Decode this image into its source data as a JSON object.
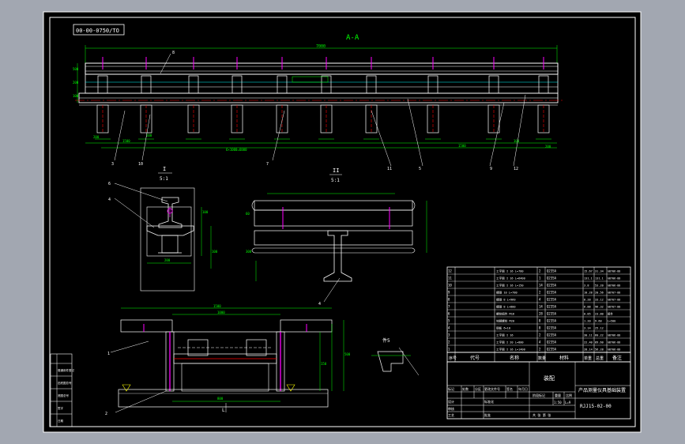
{
  "drawing": {
    "tag_label": "00-00-0750/TO",
    "section_title": "A-A",
    "detail_I_label": "I",
    "detail_I_scale": "5:1",
    "detail_II_label": "II",
    "detail_II_scale": "5:1",
    "detail_marker": "件5",
    "sub_label": "L",
    "drawing_number": "RJJ15-02-00",
    "title_text": "产品测量仪具基础装置",
    "title_caption": "装配",
    "scale_text": "1:50",
    "weight_text": "L=9",
    "top_dimension": "7000",
    "view_number_labels": [
      "3",
      "10",
      "7",
      "11",
      "5",
      "9",
      "12",
      "8",
      "6",
      "4",
      "2",
      "1"
    ],
    "section_dimensions": [
      "500",
      "200",
      "100",
      "1500",
      "200",
      "1500",
      "100",
      "200",
      "6×1000=6000",
      "200"
    ],
    "detail_dimensions": [
      "100",
      "100",
      "200",
      "500",
      "1000",
      "800",
      "150",
      "300",
      "60",
      "1500"
    ]
  },
  "bom": {
    "headers": [
      "序号",
      "代号",
      "名称",
      "数量",
      "材料",
      "单重",
      "总重",
      "备注"
    ],
    "rows": [
      {
        "no": "12",
        "name": "工字钢 I 16 L=780",
        "qty": "2",
        "mat": "Q235A",
        "w1": "15.67",
        "w2": "31.34",
        "note": "GB706-88"
      },
      {
        "no": "11",
        "name": "工字钢 I 16 L=6400",
        "qty": "1",
        "mat": "Q235A",
        "w1": "131.1",
        "w2": "131.1",
        "note": "GB706-88"
      },
      {
        "no": "10",
        "name": "工字钢 I 16 L=150",
        "qty": "14",
        "mat": "Q235A",
        "w1": "3.8",
        "w2": "53.20",
        "note": "GB706-88"
      },
      {
        "no": "9",
        "name": "槽钢 10 L=780",
        "qty": "2",
        "mat": "Q235A",
        "w1": "10.28",
        "w2": "20.56",
        "note": "GB707-88"
      },
      {
        "no": "8",
        "name": "槽钢 8 L=960",
        "qty": "4",
        "mat": "Q235A",
        "w1": "8.28",
        "w2": "33.12",
        "note": "GB707-88"
      },
      {
        "no": "7",
        "name": "槽钢 8 L=800",
        "qty": "14",
        "mat": "Q235A",
        "w1": "6.88",
        "w2": "96.32",
        "note": "GB707-88"
      },
      {
        "no": "6",
        "name": "螺栓组件 M16",
        "qty": "28",
        "mat": "Q235A",
        "w1": "0.85",
        "w2": "23.80",
        "note": "组件"
      },
      {
        "no": "5",
        "name": "地脚螺栓 M20",
        "qty": "8",
        "mat": "Q235A",
        "w1": "1.20",
        "w2": "9.60",
        "note": "L=500"
      },
      {
        "no": "4",
        "name": "钢板 δ=10",
        "qty": "8",
        "mat": "Q235A",
        "w1": "3.14",
        "w2": "25.12",
        "note": ""
      },
      {
        "no": "3",
        "name": "工字钢 I 16",
        "qty": "2",
        "mat": "Q235A",
        "w1": "30.11",
        "w2": "60.22",
        "note": "GB706-88"
      },
      {
        "no": "2",
        "name": "工字钢 I 20 L=800",
        "qty": "4",
        "mat": "Q235A",
        "w1": "22.40",
        "w2": "89.60",
        "note": "GB706-88"
      },
      {
        "no": "1",
        "name": "工字钢 I 16 L=1400",
        "qty": "2",
        "mat": "Q235A",
        "w1": "28.14",
        "w2": "56.28",
        "note": "GB706-88"
      }
    ]
  },
  "title_block": {
    "left_col": [
      "标记",
      "处数",
      "分区",
      "更改文件号",
      "签名",
      "年月日"
    ],
    "design": "设计",
    "check": "审核",
    "process": "工艺",
    "approve": "批准",
    "stage": "阶段标记",
    "weight": "重量",
    "scale": "比例",
    "sheet": "共 张 第 张",
    "std": "标准化"
  },
  "side_stamp": [
    "借通用件登记",
    "旧底图总号",
    "底图总号",
    "签字",
    "日期"
  ],
  "colors": {
    "background": "#a2a7b1",
    "paper": "#000000",
    "line_white": "#ffffff",
    "line_green": "#00ff00",
    "line_cyan": "#00ffff",
    "line_magenta": "#ff00ff",
    "line_red": "#ff0000",
    "line_yellow": "#ffff00"
  }
}
